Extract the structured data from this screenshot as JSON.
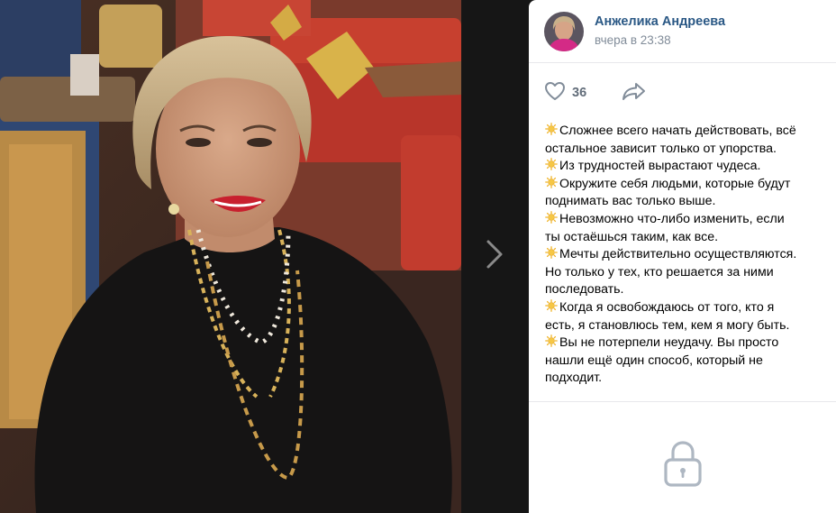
{
  "post": {
    "author_name": "Анжелика Андреева",
    "time": "вчера в 23:38",
    "likes": "36"
  },
  "text_lines": [
    {
      "sun": true,
      "text": "Сложнее всего начать действовать, всё"
    },
    {
      "sun": false,
      "text": "остальное зависит только от упорства."
    },
    {
      "sun": true,
      "text": "Из трудностей вырастают чудеса."
    },
    {
      "sun": true,
      "text": "Окружите себя людьми, которые будут"
    },
    {
      "sun": false,
      "text": "поднимать вас только выше."
    },
    {
      "sun": true,
      "text": "Невозможно что-либо изменить, если"
    },
    {
      "sun": false,
      "text": "ты остаёшься таким, как все."
    },
    {
      "sun": true,
      "text": "Мечты действительно осуществляются."
    },
    {
      "sun": false,
      "text": "Но только у тех, кто решается за ними"
    },
    {
      "sun": false,
      "text": "последовать."
    },
    {
      "sun": true,
      "text": "Когда я освобождаюсь от того, кто я"
    },
    {
      "sun": false,
      "text": "есть, я становлюсь тем, кем я могу быть."
    },
    {
      "sun": true,
      "text": "Вы не потерпели неудачу. Вы просто"
    },
    {
      "sun": false,
      "text": "нашли ещё один способ, который не"
    },
    {
      "sun": false,
      "text": "подходит."
    }
  ],
  "icons": {
    "like": "heart-icon",
    "share": "share-arrow-icon",
    "next": "chevron-right-icon",
    "lock": "lock-icon",
    "sun": "sun-emoji-icon"
  },
  "colors": {
    "author": "#2a5885",
    "meta": "#818c99",
    "icon": "#818c99",
    "panel_bg": "#ffffff",
    "viewer_bg": "#161616"
  }
}
